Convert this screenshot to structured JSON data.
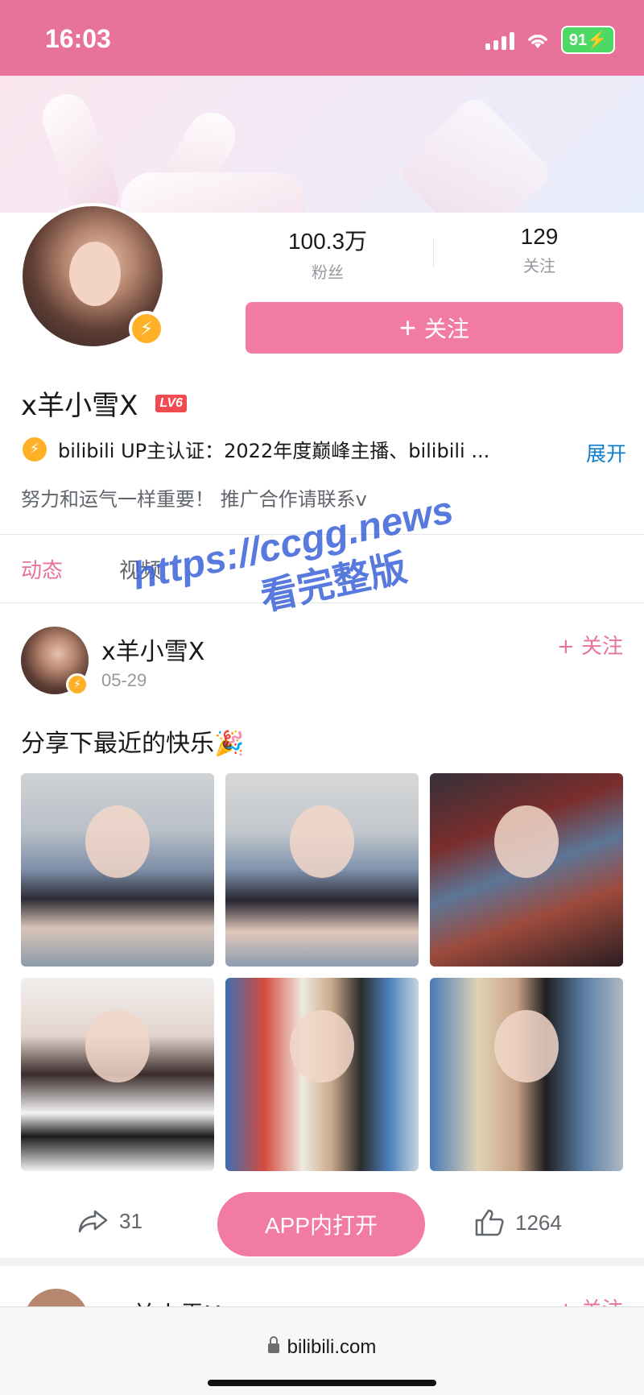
{
  "status": {
    "time": "16:03",
    "battery": "91"
  },
  "profile": {
    "fans_count": "100.3万",
    "fans_label": "粉丝",
    "following_count": "129",
    "following_label": "关注",
    "follow_button": "关注",
    "username": "x羊小雪X",
    "level": "LV6",
    "certification": "bilibili UP主认证：2022年度巅峰主播、bilibili ...",
    "expand": "展开",
    "bio": "努力和运气一样重要！ 推广合作请联系v"
  },
  "tabs": [
    {
      "label": "动态"
    },
    {
      "label": "视频"
    }
  ],
  "post": {
    "author": "x羊小雪X",
    "date": "05-29",
    "follow": "+ 关注",
    "text": "分享下最近的快乐🎉",
    "shares": "31",
    "open_app": "APP内打开",
    "likes": "1264"
  },
  "next_post": {
    "author": "x羊小雪X",
    "follow": "+ 关注"
  },
  "browser": {
    "url": "bilibili.com"
  },
  "watermark": {
    "line1": "https://ccgg.news",
    "line2": "看完整版"
  },
  "colors": {
    "accent": "#f27ba3",
    "status_bar": "#e8739a",
    "link": "#0f7dce",
    "badge": "#ffb027"
  }
}
